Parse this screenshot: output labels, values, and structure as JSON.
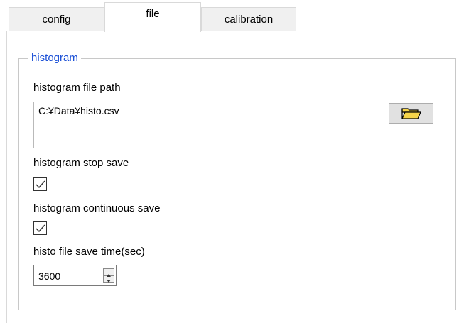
{
  "tabs": [
    {
      "label": "config",
      "active": false
    },
    {
      "label": "file",
      "active": true
    },
    {
      "label": "calibration",
      "active": false
    }
  ],
  "group": {
    "title": "histogram"
  },
  "fields": {
    "path_label": "histogram file path",
    "path_value": "C:¥Data¥histo.csv",
    "stop_save_label": "histogram stop save",
    "stop_save_checked": true,
    "continuous_save_label": "histogram continuous save",
    "continuous_save_checked": true,
    "save_time_label": "histo file save time(sec)",
    "save_time_value": "3600"
  },
  "icons": {
    "browse": "folder-open-icon",
    "checkmark": "checkmark-icon",
    "spin_up": "arrow-up-icon",
    "spin_down": "arrow-down-icon"
  },
  "colors": {
    "group_title": "#1a4fd6",
    "folder_fill": "#f5d44a"
  }
}
